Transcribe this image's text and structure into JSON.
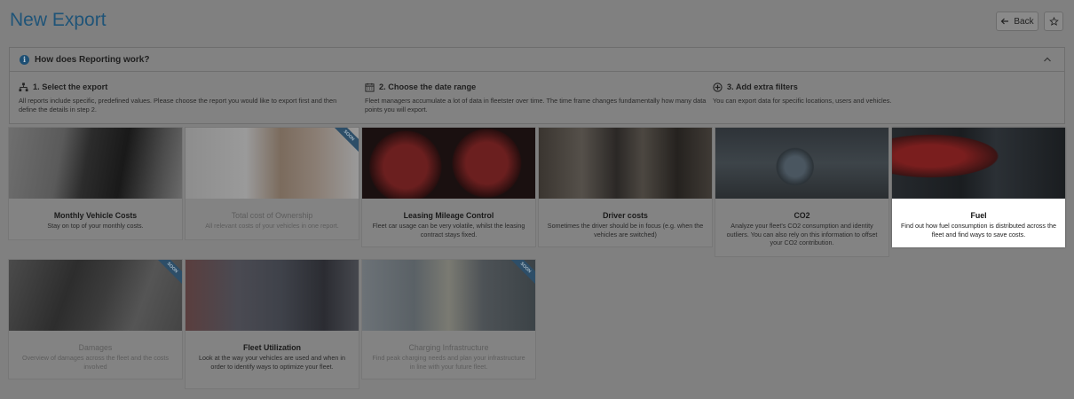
{
  "header": {
    "title": "New Export",
    "back_label": "Back"
  },
  "info": {
    "title": "How does Reporting work?",
    "steps": [
      {
        "title": "1. Select the export",
        "text": "All reports include specific, predefined values. Please choose the report you would like to export first and then define the details in step 2."
      },
      {
        "title": "2. Choose the date range",
        "text": "Fleet managers accumulate a lot of data in fleetster over time. The time frame changes fundamentally how many data points you will export."
      },
      {
        "title": "3. Add extra filters",
        "text": "You can export data for specific locations, users and vehicles."
      }
    ]
  },
  "cards": [
    {
      "title": "Monthly Vehicle Costs",
      "desc": "Stay on top of your monthly costs."
    },
    {
      "title": "Total cost of Ownership",
      "desc": "All relevant costs of your vehicles in one report.",
      "badge": "SOON"
    },
    {
      "title": "Leasing Mileage Control",
      "desc": "Fleet car usage can be very volatile, whilst the leasing contract stays fixed."
    },
    {
      "title": "Driver costs",
      "desc": "Sometimes the driver should be in focus (e.g. when the vehicles are switched)"
    },
    {
      "title": "CO2",
      "desc": "Analyze your fleet's CO2 consumption and identity outliers. You can also rely on this information to offset your CO2 contribution."
    },
    {
      "title": "Fuel",
      "desc": "Find out how fuel consumption is distributed across the fleet and find ways to save costs."
    },
    {
      "title": "Damages",
      "desc": "Overview of damages across the fleet and the costs involved",
      "badge": "SOON"
    },
    {
      "title": "Fleet Utilization",
      "desc": "Look at the way your vehicles are used and when in order to identify ways to optimize your fleet."
    },
    {
      "title": "Charging Infrastructure",
      "desc": "Find peak charging needs and plan your infrastructure in line with your future fleet.",
      "badge": "SOON"
    }
  ]
}
